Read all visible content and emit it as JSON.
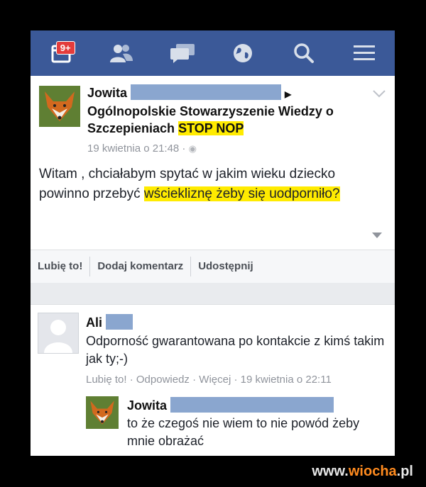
{
  "nav": {
    "notification_count": "9+",
    "items": [
      "feed-icon",
      "friends-icon",
      "messages-icon",
      "globe-icon",
      "search-icon",
      "menu-icon"
    ]
  },
  "post": {
    "author": "Jowita",
    "group": "Ogólnopolskie Stowarzyszenie Wiedzy o Szczepieniach",
    "group_highlight": "STOP NOP",
    "timestamp": "19 kwietnia o 21:48 ·",
    "body_plain": "Witam , chciałabym spytać w jakim wieku dziecko powinno przebyć",
    "body_highlight": "wściekliznę żeby się uodporniło?"
  },
  "actions": {
    "like": "Lubię to!",
    "comment": "Dodaj komentarz",
    "share": "Udostępnij"
  },
  "comments": [
    {
      "author": "Ali",
      "text": "Odporność gwarantowana po kontakcie z kimś takim jak ty;-)",
      "like": "Lubię to!",
      "reply": "Odpowiedz",
      "more": "Więcej",
      "time": "19 kwietnia o 22:11"
    },
    {
      "author": "Jowita",
      "text": "to że czegoś nie wiem to nie powód żeby mnie obrażać"
    }
  ],
  "watermark": {
    "prefix": "www.",
    "accent": "wiocha",
    "suffix": ".pl"
  },
  "colors": {
    "nav_bg": "#3b5998",
    "highlight": "#ffeb00",
    "redaction": "#8aa6cf"
  }
}
